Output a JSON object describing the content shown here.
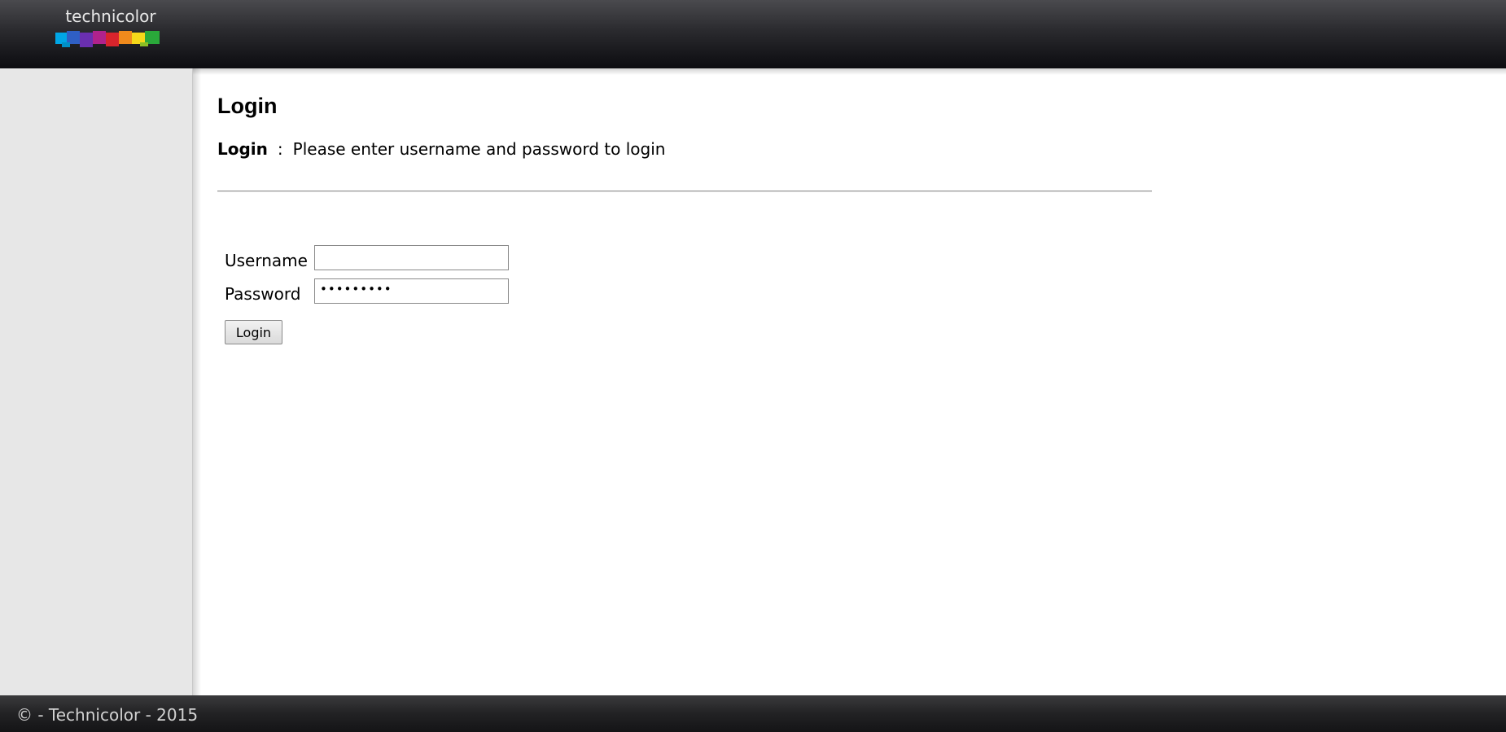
{
  "header": {
    "logo_text": "technicolor"
  },
  "main": {
    "title": "Login",
    "intro_label": "Login",
    "intro_separator": ":",
    "intro_text": "Please enter username and password to login"
  },
  "form": {
    "username_label": "Username",
    "username_value": "",
    "password_label": "Password",
    "password_masked": "•••••••••",
    "login_button": "Login"
  },
  "footer": {
    "copyright": "© - Technicolor - 2015"
  },
  "colors": {
    "header_bg": "#0c0c10",
    "sidebar_bg": "#e7e7e7",
    "footer_bg": "#1c1c1e",
    "footer_text": "#d2d2d2",
    "logo_bar_colors": [
      "#00a6e6",
      "#2f5fc4",
      "#6a2fb0",
      "#b0228c",
      "#d8242c",
      "#f08a1c",
      "#f6d81a",
      "#2aa83a"
    ]
  },
  "icons": {
    "logo": "technicolor-logo"
  }
}
